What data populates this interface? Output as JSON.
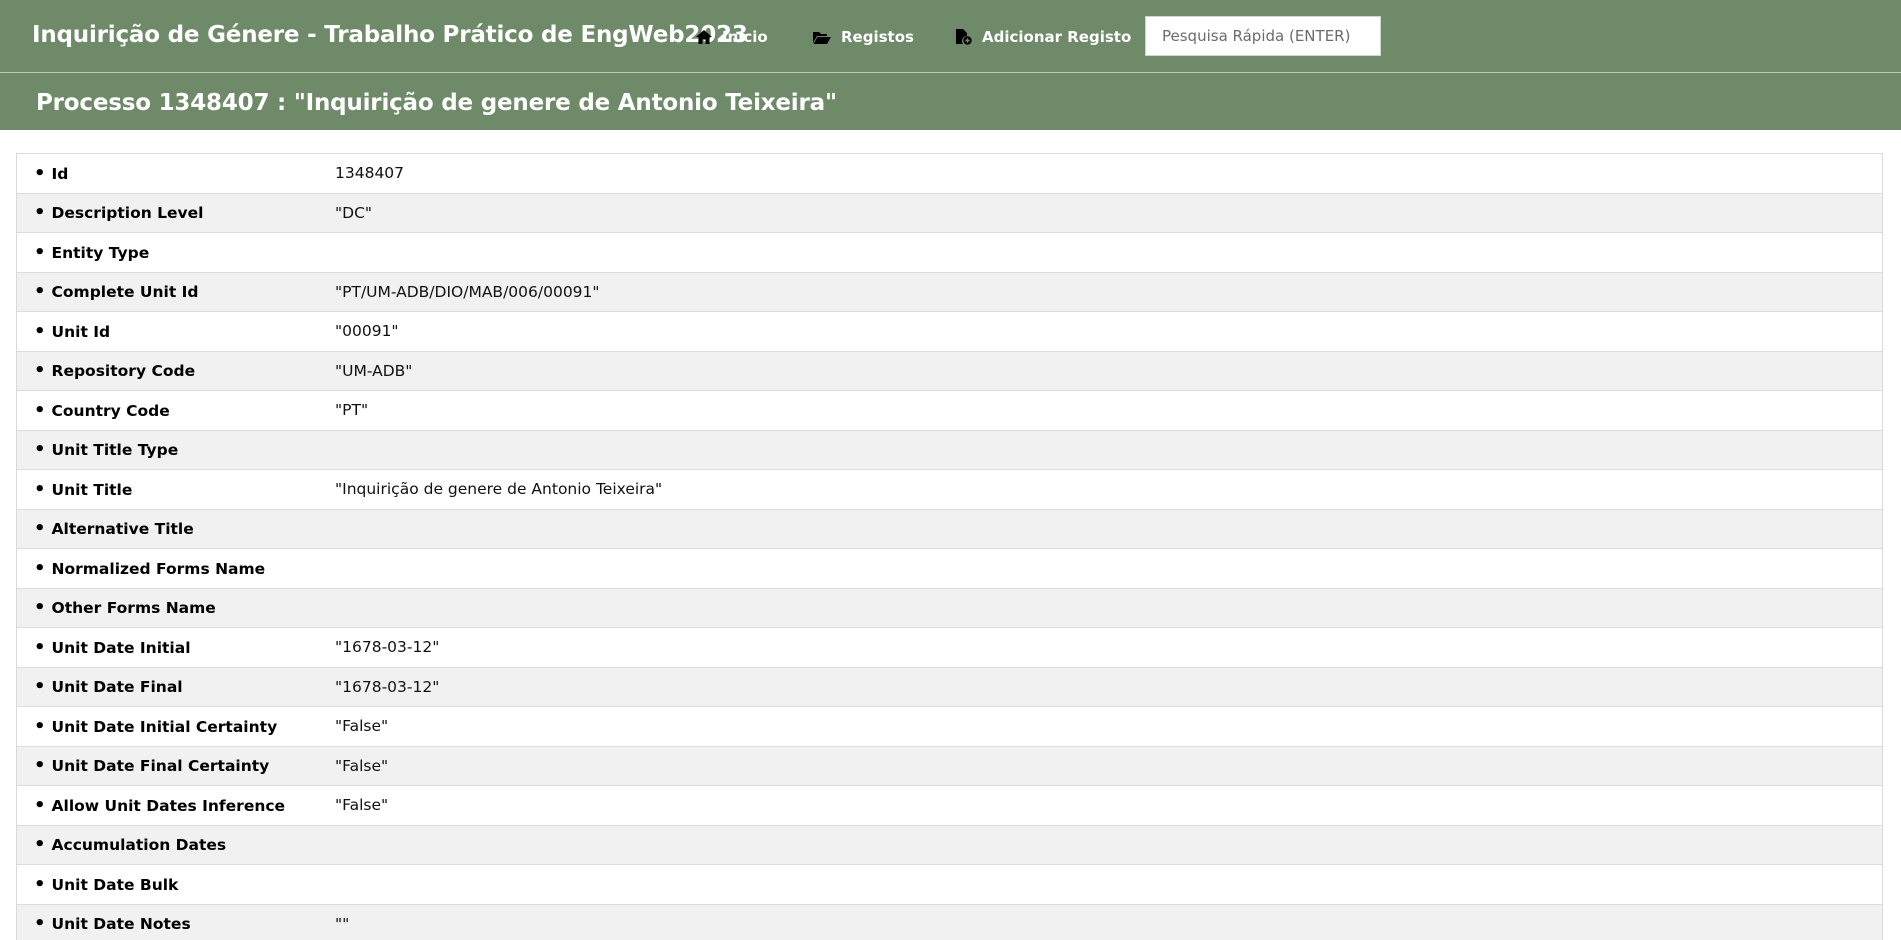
{
  "header": {
    "app_title": "Inquirição de Génere - Trabalho Prático de EngWeb2023",
    "nav": [
      {
        "label": "Início",
        "icon": "home-icon"
      },
      {
        "label": "Registos",
        "icon": "folder-open-icon"
      },
      {
        "label": "Adicionar Registo",
        "icon": "file-add-icon"
      }
    ],
    "search_placeholder": "Pesquisa Rápida (ENTER)",
    "search_value": ""
  },
  "page": {
    "title": "Processo 1348407 : \"Inquirição de genere de Antonio Teixeira\""
  },
  "colors": {
    "header_bg": "#6e8a68",
    "row_alt": "#f1f1f1"
  },
  "record": {
    "rows": [
      {
        "label": "Id",
        "value": "1348407"
      },
      {
        "label": "Description Level",
        "value": "\"DC\""
      },
      {
        "label": "Entity Type",
        "value": ""
      },
      {
        "label": "Complete Unit Id",
        "value": "\"PT/UM-ADB/DIO/MAB/006/00091\""
      },
      {
        "label": "Unit Id",
        "value": "\"00091\""
      },
      {
        "label": "Repository Code",
        "value": "\"UM-ADB\""
      },
      {
        "label": "Country Code",
        "value": "\"PT\""
      },
      {
        "label": "Unit Title Type",
        "value": ""
      },
      {
        "label": "Unit Title",
        "value": "\"Inquirição de genere de Antonio Teixeira\""
      },
      {
        "label": "Alternative Title",
        "value": ""
      },
      {
        "label": "Normalized Forms Name",
        "value": ""
      },
      {
        "label": "Other Forms Name",
        "value": ""
      },
      {
        "label": "Unit Date Initial",
        "value": "\"1678-03-12\""
      },
      {
        "label": "Unit Date Final",
        "value": "\"1678-03-12\""
      },
      {
        "label": "Unit Date Initial Certainty",
        "value": "\"False\""
      },
      {
        "label": "Unit Date Final Certainty",
        "value": "\"False\""
      },
      {
        "label": "Allow Unit Dates Inference",
        "value": "\"False\""
      },
      {
        "label": "Accumulation Dates",
        "value": ""
      },
      {
        "label": "Unit Date Bulk",
        "value": ""
      },
      {
        "label": "Unit Date Notes",
        "value": "\"\""
      }
    ]
  }
}
